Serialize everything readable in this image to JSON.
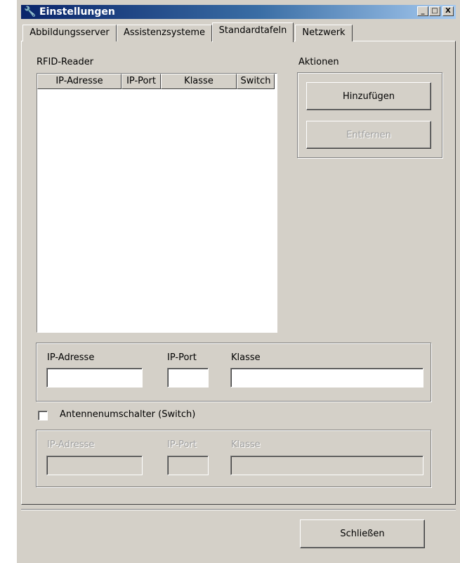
{
  "window": {
    "title": "Einstellungen",
    "icon": "wrench-icon",
    "controls": {
      "minimize": "_",
      "maximize": "□",
      "close": "X"
    }
  },
  "tabs": [
    {
      "label": "Abbildungsserver",
      "active": false
    },
    {
      "label": "Assistenzsysteme",
      "active": false
    },
    {
      "label": "Standardtafeln",
      "active": true
    },
    {
      "label": "Netzwerk",
      "active": false
    }
  ],
  "rfid": {
    "group_label": "RFID-Reader",
    "columns": [
      "IP-Adresse",
      "IP-Port",
      "Klasse",
      "Switch"
    ],
    "rows": []
  },
  "actions": {
    "group_label": "Aktionen",
    "add_label": "Hinzufügen",
    "remove_label": "Entfernen",
    "remove_enabled": false
  },
  "reader_fields": {
    "ip_label": "IP-Adresse",
    "port_label": "IP-Port",
    "class_label": "Klasse",
    "ip_value": "",
    "port_value": "",
    "class_value": ""
  },
  "switch": {
    "checkbox_label": "Antennenumschalter (Switch)",
    "checked": false,
    "ip_label": "IP-Adresse",
    "port_label": "IP-Port",
    "class_label": "Klasse",
    "enabled": false
  },
  "footer": {
    "close_label": "Schließen"
  }
}
